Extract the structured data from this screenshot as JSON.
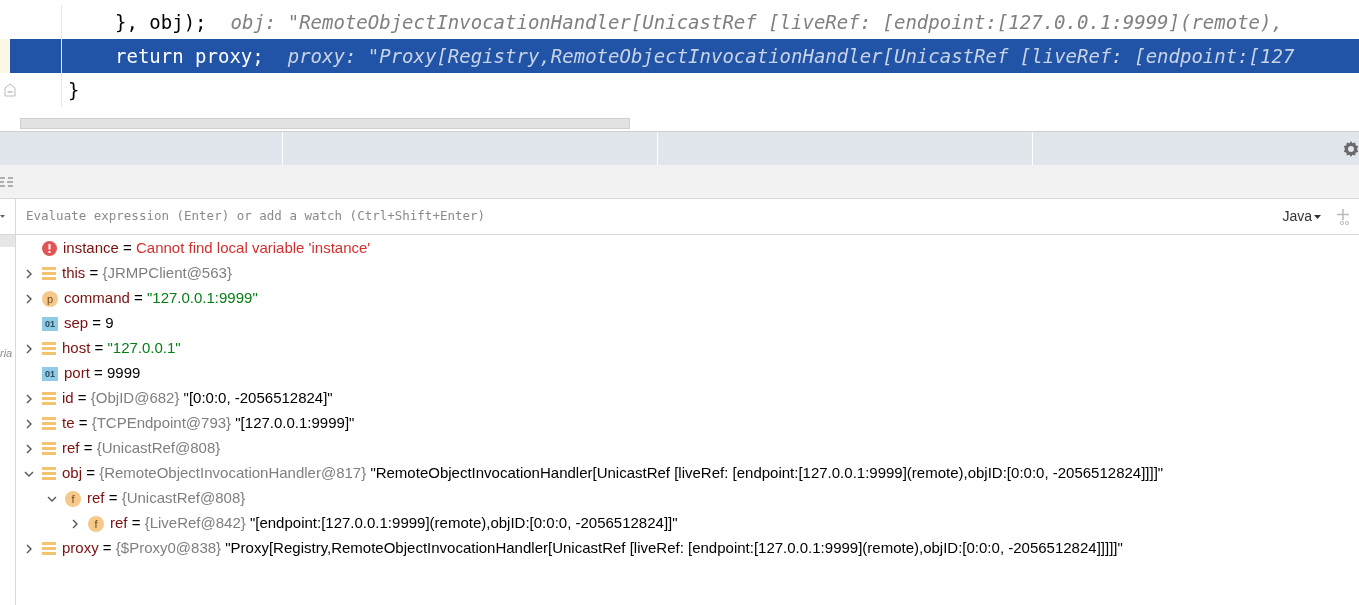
{
  "editor": {
    "lines": [
      {
        "code": "}, obj);",
        "hint": "obj: \"RemoteObjectInvocationHandler[UnicastRef [liveRef: [endpoint:[127.0.0.1:9999](remote),",
        "selected": false,
        "fold": false
      },
      {
        "code": "return proxy;",
        "hint": "proxy: \"Proxy[Registry,RemoteObjectInvocationHandler[UnicastRef [liveRef: [endpoint:[127",
        "selected": true,
        "fold": false
      },
      {
        "code": "}",
        "fold": true,
        "selected": false
      }
    ]
  },
  "side_label": "ria",
  "watch": {
    "placeholder": "Evaluate expression (Enter) or add a watch (Ctrl+Shift+Enter)",
    "language": "Java"
  },
  "variables": [
    {
      "kind": "error",
      "name": "instance",
      "operator": "=",
      "value": "Cannot find local variable 'instance'"
    },
    {
      "kind": "object",
      "name": "this",
      "operator": "=",
      "expanded": false,
      "type": "{JRMPClient@563}"
    },
    {
      "kind": "param",
      "badge": "p",
      "name": "command",
      "operator": "=",
      "expanded": false,
      "value": "\"127.0.0.1:9999\"",
      "is_string": true
    },
    {
      "kind": "primitive",
      "badge": "01",
      "name": "sep",
      "operator": "=",
      "value": "9",
      "is_string": false
    },
    {
      "kind": "object",
      "name": "host",
      "operator": "=",
      "expanded": false,
      "value": "\"127.0.0.1\"",
      "is_string": true
    },
    {
      "kind": "primitive",
      "badge": "01",
      "name": "port",
      "operator": "=",
      "value": "9999",
      "is_string": false
    },
    {
      "kind": "object",
      "name": "id",
      "operator": "=",
      "expanded": false,
      "type": "{ObjID@682}",
      "value": "\"[0:0:0, -2056512824]\"",
      "is_string": false
    },
    {
      "kind": "object",
      "name": "te",
      "operator": "=",
      "expanded": false,
      "type": "{TCPEndpoint@793}",
      "value": "\"[127.0.0.1:9999]\"",
      "is_string": false
    },
    {
      "kind": "object",
      "name": "ref",
      "operator": "=",
      "expanded": false,
      "type": "{UnicastRef@808}"
    },
    {
      "kind": "object",
      "name": "obj",
      "operator": "=",
      "expanded": true,
      "type": "{RemoteObjectInvocationHandler@817}",
      "value": "\"RemoteObjectInvocationHandler[UnicastRef [liveRef: [endpoint:[127.0.0.1:9999](remote),objID:[0:0:0, -2056512824]]]]\"",
      "is_string": false,
      "children": [
        {
          "kind": "field",
          "badge": "f",
          "name": "ref",
          "operator": "=",
          "expanded": true,
          "type": "{UnicastRef@808}",
          "children": [
            {
              "kind": "field",
              "badge": "f",
              "name": "ref",
              "operator": "=",
              "expanded": false,
              "type": "{LiveRef@842}",
              "value": "\"[endpoint:[127.0.0.1:9999](remote),objID:[0:0:0, -2056512824]]\"",
              "is_string": false
            }
          ]
        }
      ]
    },
    {
      "kind": "object",
      "name": "proxy",
      "operator": "=",
      "expanded": false,
      "type": "{$Proxy0@838}",
      "value": "\"Proxy[Registry,RemoteObjectInvocationHandler[UnicastRef [liveRef: [endpoint:[127.0.0.1:9999](remote),objID:[0:0:0, -2056512824]]]]]\"",
      "is_string": false
    }
  ]
}
